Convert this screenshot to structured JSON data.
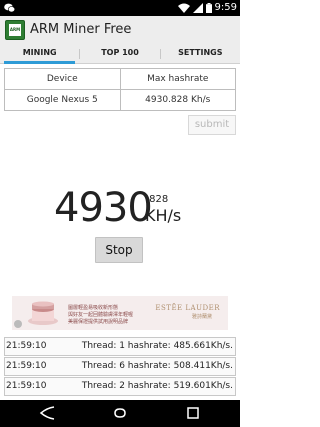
{
  "status_bar": {
    "time": "9:59"
  },
  "app": {
    "title": "ARM Miner Free",
    "icon_label": "ARM"
  },
  "tabs": [
    {
      "label": "MINING",
      "active": true
    },
    {
      "label": "TOP 100",
      "active": false
    },
    {
      "label": "SETTINGS",
      "active": false
    }
  ],
  "device_table": {
    "headers": [
      "Device",
      "Max hashrate"
    ],
    "row": [
      "Google Nexus 5",
      "4930.828 Kh/s"
    ]
  },
  "submit_label": "submit",
  "hashrate": {
    "integer": "4930",
    "decimal": ".828",
    "unit": "KH/s"
  },
  "stop_label": "Stop",
  "ad": {
    "text_line1": "圖層輕盈易吸收新形態",
    "text_line2": "與好友一起回體驗膚澤年輕喔",
    "text_line3": "美麗保證提供試用說明品牌",
    "brand": "ESTĒE LAUDER",
    "brand_sub": "雅詩蘭黛"
  },
  "logs": [
    {
      "time": "21:59:10",
      "message": "Thread: 1 hashrate: 485.661Kh/s."
    },
    {
      "time": "21:59:10",
      "message": "Thread: 6 hashrate: 508.411Kh/s."
    },
    {
      "time": "21:59:10",
      "message": "Thread: 2 hashrate: 519.601Kh/s."
    }
  ],
  "colors": {
    "accent": "#2e9bd6",
    "app_icon": "#2e7d32"
  }
}
